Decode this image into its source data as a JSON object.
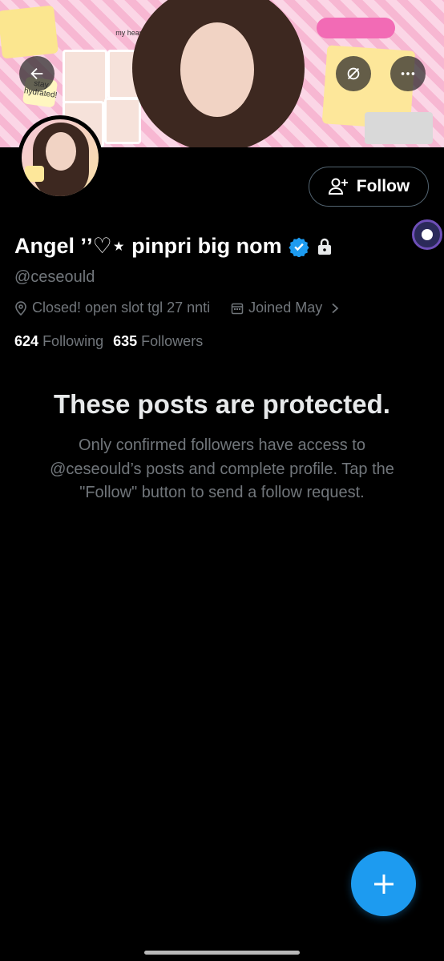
{
  "header": {
    "back_icon": "arrow-left-icon",
    "refresh_icon": "refresh-slash-icon",
    "more_icon": "more-horizontal-icon",
    "banner_stickers": [
      "stay hydrated!",
      "my heart!"
    ]
  },
  "profile": {
    "display_name": "Angel ʼʼ♡⋆ pinpri big nom",
    "handle": "@ceseould",
    "verified": true,
    "protected": true,
    "location": "Closed! open slot tgl 27 nnti",
    "joined": "Joined May",
    "following_count": "624",
    "following_label": "Following",
    "followers_count": "635",
    "followers_label": "Followers"
  },
  "follow_button": {
    "label": "Follow",
    "icon": "add-user-icon"
  },
  "protected_notice": {
    "title": "These posts are protected.",
    "body": "Only confirmed followers have access to @ceseould’s posts and complete profile. Tap the \"Follow\" button to send a follow request."
  },
  "fab": {
    "icon": "plus-icon"
  },
  "colors": {
    "accent": "#1d9bf0",
    "background": "#000000",
    "muted": "#71767b"
  }
}
